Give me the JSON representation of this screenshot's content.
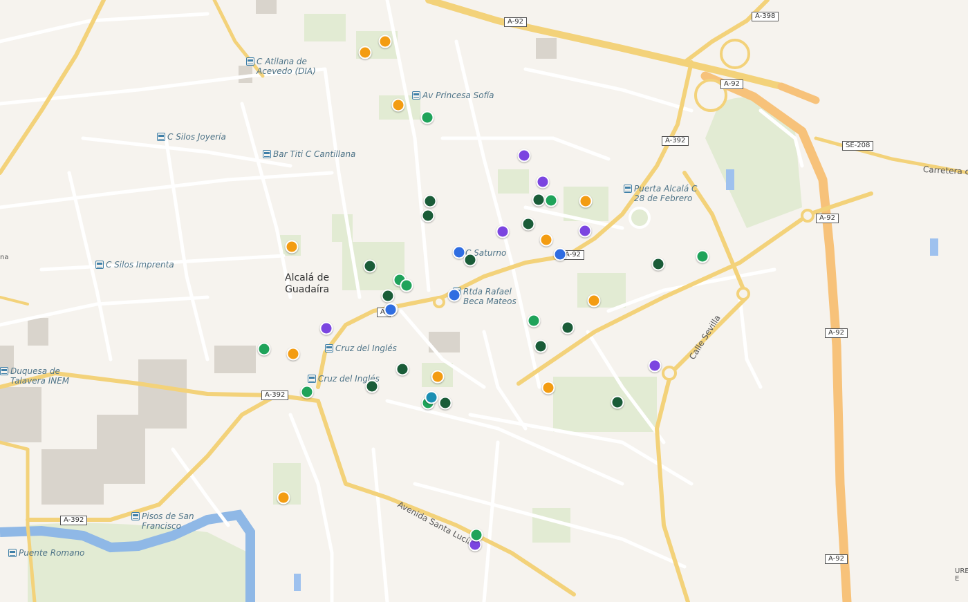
{
  "colors": {
    "background": "#f6f3ee",
    "road_major": "#f3d27a",
    "road_minor": "#ffffff",
    "park": "#e2ebd3",
    "water": "#8fb8e6",
    "building": "#d9d4cc",
    "orange": "#f39c12",
    "green": "#1fa35a",
    "darkgreen": "#1a5c38",
    "purple": "#7b45e0",
    "blue": "#2f6de1",
    "teal": "#1b8fb3"
  },
  "place_label": "Alcalá de\nGuadaíra",
  "transit_stops": [
    {
      "name": "C Atilana de\nAcevedo (DIA)"
    },
    {
      "name": "Av Princesa Sofía"
    },
    {
      "name": "C Silos Joyería"
    },
    {
      "name": "Bar Titi C Cantillana"
    },
    {
      "name": "Puerta Alcalá C\n28 de Febrero"
    },
    {
      "name": "C Silos Imprenta"
    },
    {
      "name": "C Saturno"
    },
    {
      "name": "Rtda Rafael\nBeca Mateos"
    },
    {
      "name": "Cruz del Inglés"
    },
    {
      "name": "Cruz del Inglés"
    },
    {
      "name": "Duquesa de\nTalavera INEM"
    },
    {
      "name": "Pisos de San\nFrancisco"
    },
    {
      "name": "Puente Romano"
    }
  ],
  "road_shields": [
    {
      "ref": "A-92"
    },
    {
      "ref": "A-398"
    },
    {
      "ref": "A-92"
    },
    {
      "ref": "A-392"
    },
    {
      "ref": "SE-208"
    },
    {
      "ref": "A-92"
    },
    {
      "ref": "A-92"
    },
    {
      "ref": "A-92"
    },
    {
      "ref": "A-92"
    },
    {
      "ref": "A-392"
    },
    {
      "ref": "A-392"
    },
    {
      "ref": "A-"
    }
  ],
  "street_labels": [
    {
      "name": "Avenida Santa Lucía"
    },
    {
      "name": "Calle Sevilla"
    },
    {
      "name": "Carretera d"
    }
  ],
  "edge_labels": [
    {
      "text": "URE\nE"
    },
    {
      "text": "na"
    }
  ],
  "markers": [
    {
      "color": "orange"
    },
    {
      "color": "orange"
    },
    {
      "color": "orange"
    },
    {
      "color": "green"
    },
    {
      "color": "purple"
    },
    {
      "color": "purple"
    },
    {
      "color": "darkgreen"
    },
    {
      "color": "green"
    },
    {
      "color": "orange"
    },
    {
      "color": "darkgreen"
    },
    {
      "color": "darkgreen"
    },
    {
      "color": "purple"
    },
    {
      "color": "darkgreen"
    },
    {
      "color": "purple"
    },
    {
      "color": "orange"
    },
    {
      "color": "blue"
    },
    {
      "color": "darkgreen"
    },
    {
      "color": "blue"
    },
    {
      "color": "orange"
    },
    {
      "color": "darkgreen"
    },
    {
      "color": "green"
    },
    {
      "color": "green"
    },
    {
      "color": "darkgreen"
    },
    {
      "color": "darkgreen"
    },
    {
      "color": "blue"
    },
    {
      "color": "blue"
    },
    {
      "color": "orange"
    },
    {
      "color": "green"
    },
    {
      "color": "darkgreen"
    },
    {
      "color": "purple"
    },
    {
      "color": "green"
    },
    {
      "color": "orange"
    },
    {
      "color": "darkgreen"
    },
    {
      "color": "darkgreen"
    },
    {
      "color": "purple"
    },
    {
      "color": "darkgreen"
    },
    {
      "color": "orange"
    },
    {
      "color": "darkgreen"
    },
    {
      "color": "green"
    },
    {
      "color": "teal"
    },
    {
      "color": "green"
    },
    {
      "color": "darkgreen"
    },
    {
      "color": "orange"
    },
    {
      "color": "darkgreen"
    },
    {
      "color": "orange"
    },
    {
      "color": "green"
    },
    {
      "color": "purple"
    },
    {
      "color": "green"
    }
  ]
}
